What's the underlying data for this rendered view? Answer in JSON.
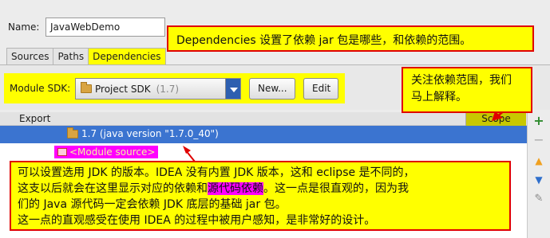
{
  "form": {
    "name_label": "Name:",
    "name_value": "JavaWebDemo"
  },
  "tabs": [
    {
      "label": "Sources",
      "active": false
    },
    {
      "label": "Paths",
      "active": false
    },
    {
      "label": "Dependencies",
      "active": true
    }
  ],
  "sdk": {
    "label": "Module SDK:",
    "selected": "Project SDK",
    "selected_version": "(1.7)",
    "new_button": "New...",
    "edit_button": "Edit"
  },
  "table": {
    "columns": {
      "export": "Export",
      "scope": "Scope"
    },
    "rows": [
      {
        "label": "1.7 (java version \"1.7.0_40\")",
        "selected": true,
        "icon": "folder-icon"
      },
      {
        "label": "<Module source>",
        "selected": false,
        "icon": "module-source-icon"
      }
    ]
  },
  "toolbar": {
    "add": "+",
    "remove": "−",
    "move_up": "▲",
    "move_down": "▼",
    "edit": "✎"
  },
  "annotations": {
    "dependencies_note": "Dependencies 设置了依赖 jar 包是哪些，和依赖的范围。",
    "scope_note_line1": "关注依赖范围，我们",
    "scope_note_line2": "马上解释。",
    "main_line1": "可以设置选用 JDK 的版本。IDEA 没有内置 JDK 版本，这和 eclipse 是不同的，",
    "main_line2_a": "这支以后就会在这里显示对应的依赖和",
    "main_line2_highlight": "源代码依赖",
    "main_line2_b": "。这一点是很直观的，因为我",
    "main_line3": "们的 Java 源代码一定会依赖 JDK 底层的基础 jar 包。",
    "main_line4": "这一点的直观感受在使用 IDEA 的过程中被用户感知，是非常好的设计。"
  },
  "colors": {
    "highlight_yellow": "#ffff00",
    "callout_border": "#e00000",
    "selection_blue": "#3b74d0",
    "magenta": "#ff00ff",
    "add_green": "#2e8b2e"
  }
}
